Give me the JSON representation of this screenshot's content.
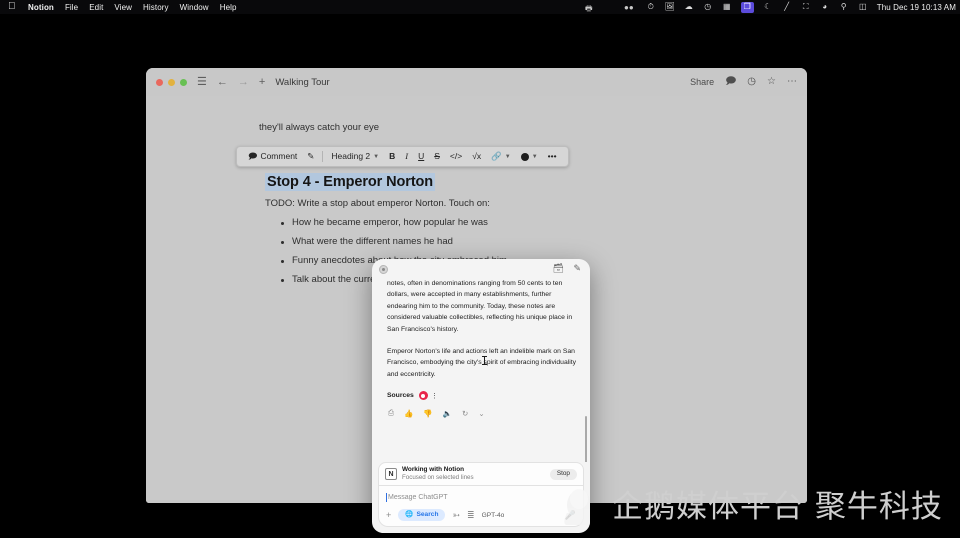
{
  "menubar": {
    "apple_icon": "apple-logo",
    "items": [
      "Notion",
      "File",
      "Edit",
      "View",
      "History",
      "Window",
      "Help"
    ],
    "status_icons": [
      "printer-icon",
      "airpods-icon",
      "stopwatch-icon",
      "screenshot-icon",
      "cloud-icon",
      "clock-icon",
      "grid-icon",
      "stage-manager-icon",
      "moon-icon",
      "pen-icon",
      "battery-icon",
      "wifi-icon",
      "search-icon",
      "control-center-icon"
    ],
    "clock": "Thu Dec 19  10:13 AM"
  },
  "notion": {
    "titlebar": {
      "sidebar_icon": "hamburger-icon",
      "back_icon": "arrow-left-icon",
      "forward_icon": "arrow-right-icon",
      "new_icon": "plus-icon",
      "title": "Walking Tour",
      "share_label": "Share",
      "comment_icon": "comment-icon",
      "history_icon": "clock-icon",
      "favorite_icon": "star-icon",
      "more_icon": "ellipsis-icon"
    },
    "previous_line": "they'll always catch your eye",
    "toolbar": {
      "comment_label": "Comment",
      "comment_icon": "comment-icon",
      "ai_icon": "ai-edit-icon",
      "block_type": "Heading 2",
      "bold": "B",
      "italic": "I",
      "underline": "U",
      "strikethrough": "S",
      "code": "</>",
      "equation": "√x",
      "link_icon": "link-icon",
      "color_icon": "color-swatch-icon",
      "more": "•••"
    },
    "document": {
      "heading": "Stop 4 - Emperor Norton",
      "todo": "TODO: Write a stop about emperor Norton. Touch on:",
      "bullets": [
        "How he became emperor, how popular he was",
        "What were the different names he had",
        "Funny anecdotes about how the city embraced him.",
        "Talk about the currency that he created"
      ]
    }
  },
  "chat_panel": {
    "header": {
      "menu_icon": "settings-dot-icon",
      "history_icon": "chat-history-icon",
      "new_chat_icon": "compose-icon"
    },
    "paragraphs": [
      "notes, often in denominations ranging from 50 cents to ten dollars, were accepted in many establishments, further endearing him to the community. Today, these notes are considered valuable collectibles, reflecting his unique place in San Francisco's history.",
      "Emperor Norton's life and actions left an indelible mark on San Francisco, embodying the city's spirit of embracing individuality and eccentricity."
    ],
    "sources_label": "Sources",
    "sources_badge_color": "#e8254a",
    "message_actions": [
      "copy-icon",
      "thumbs-up-icon",
      "thumbs-down-icon",
      "speaker-icon",
      "regenerate-icon",
      "chevron-down-icon"
    ],
    "context": {
      "app_badge": "N",
      "title": "Working with Notion",
      "subtitle": "Focused on selected lines",
      "stop_label": "Stop"
    },
    "composer": {
      "placeholder": "Message ChatGPT",
      "value": "",
      "attach_icon": "plus-icon",
      "search_label": "Search",
      "search_icon": "globe-icon",
      "cursor_icon": "pointer-icon",
      "tools_icon": "sliders-icon",
      "model_label": "GPT-4o",
      "mic_icon": "microphone-icon"
    }
  },
  "watermark": {
    "text": "企鹅媒体平台 聚牛科技",
    "logo": "qq-penguin-logo"
  }
}
